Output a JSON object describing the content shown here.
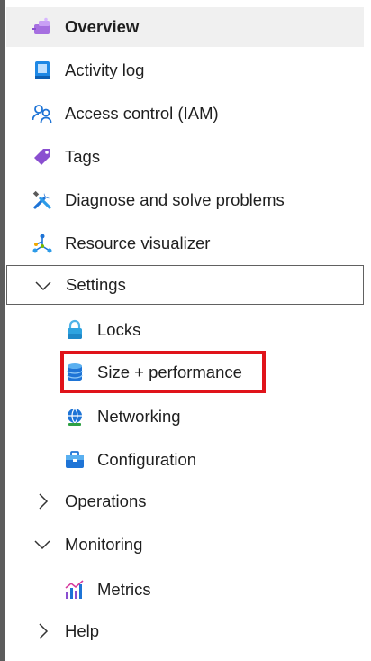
{
  "menu": {
    "items": [
      {
        "label": "Overview",
        "icon": "overview-icon",
        "selected": true
      },
      {
        "label": "Activity log",
        "icon": "activity-log-icon"
      },
      {
        "label": "Access control (IAM)",
        "icon": "access-control-icon"
      },
      {
        "label": "Tags",
        "icon": "tag-icon"
      },
      {
        "label": "Diagnose and solve problems",
        "icon": "wrench-icon"
      },
      {
        "label": "Resource visualizer",
        "icon": "resource-visualizer-icon"
      }
    ],
    "settings": {
      "label": "Settings",
      "expanded": true,
      "children": [
        {
          "label": "Locks",
          "icon": "lock-icon"
        },
        {
          "label": "Size + performance",
          "icon": "database-icon",
          "highlighted": true
        },
        {
          "label": "Networking",
          "icon": "networking-icon"
        },
        {
          "label": "Configuration",
          "icon": "configuration-icon"
        }
      ]
    },
    "operations": {
      "label": "Operations",
      "expanded": false
    },
    "monitoring": {
      "label": "Monitoring",
      "expanded": true,
      "children": [
        {
          "label": "Metrics",
          "icon": "metrics-icon"
        }
      ]
    },
    "help": {
      "label": "Help",
      "expanded": false
    }
  },
  "colors": {
    "highlight_border": "#e0131a",
    "selected_background": "#f0f0f0",
    "accent_blue": "#0078d4"
  }
}
